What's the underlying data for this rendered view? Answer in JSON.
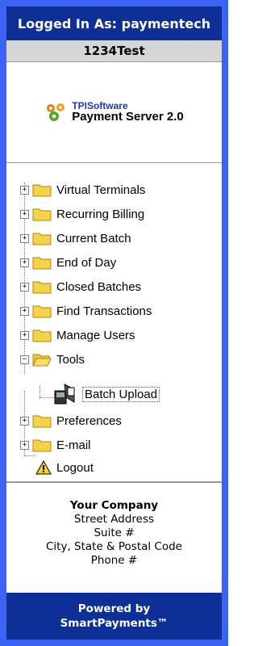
{
  "header": {
    "logged_in_as": "Logged In As: paymentech",
    "account": "1234Test"
  },
  "logo": {
    "brand": "TPISoftware",
    "product": "Payment Server 2.0"
  },
  "nav": {
    "items": [
      {
        "label": "Virtual Terminals",
        "expander": "+"
      },
      {
        "label": "Recurring Billing",
        "expander": "+"
      },
      {
        "label": "Current Batch",
        "expander": "+"
      },
      {
        "label": "End of Day",
        "expander": "+"
      },
      {
        "label": "Closed Batches",
        "expander": "+"
      },
      {
        "label": "Find Transactions",
        "expander": "+"
      },
      {
        "label": "Manage Users",
        "expander": "+"
      },
      {
        "label": "Tools",
        "expander": "−"
      },
      {
        "label": "Batch Upload"
      },
      {
        "label": "Preferences",
        "expander": "+"
      },
      {
        "label": "E-mail",
        "expander": "+"
      },
      {
        "label": "Logout"
      }
    ]
  },
  "company": {
    "name": "Your Company",
    "street": "Street Address",
    "suite": "Suite #",
    "city": "City, State & Postal Code",
    "phone": "Phone #"
  },
  "footer": {
    "line1": "Powered by",
    "line2": "SmartPayments™"
  },
  "colors": {
    "frame": "#3a62f5",
    "navy": "#0e2f96",
    "folder": "#f5d24a"
  }
}
